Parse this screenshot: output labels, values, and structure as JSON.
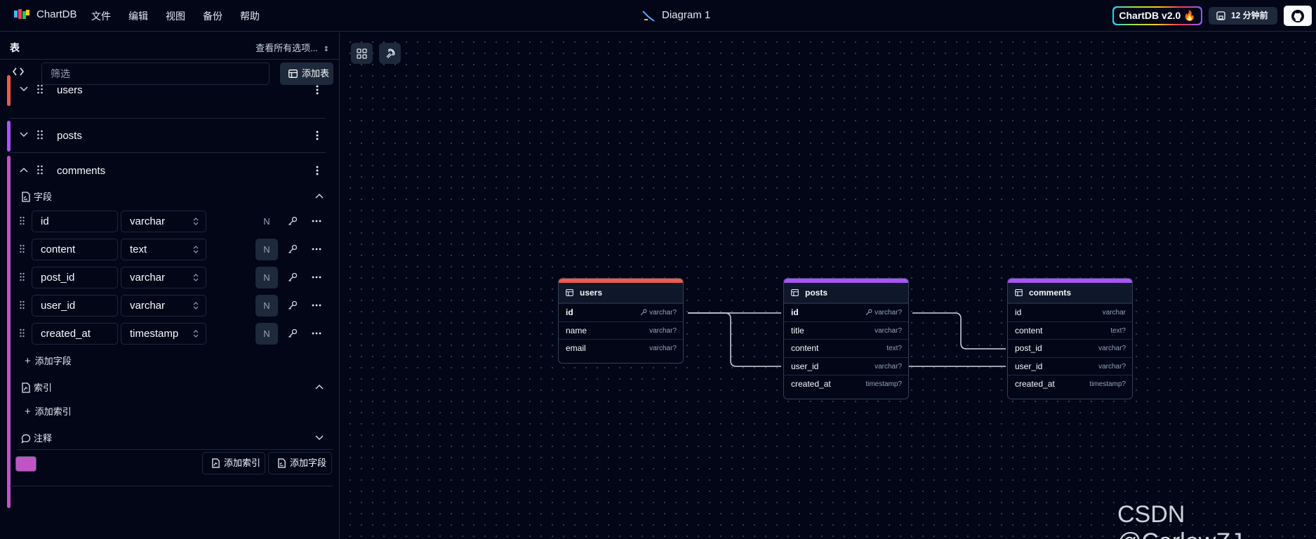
{
  "app": {
    "brand": "ChartDB",
    "menu": [
      "文件",
      "编辑",
      "视图",
      "备份",
      "帮助"
    ],
    "diagram_title": "Diagram 1",
    "version_label": "ChartDB v2.0 🔥",
    "saved_label": "12 分钟前"
  },
  "sidebar": {
    "title": "表",
    "view_all": "查看所有选项...",
    "filter_placeholder": "筛选",
    "add_table": "添加表",
    "tables": [
      {
        "name": "users",
        "color": "#ef5a4c"
      },
      {
        "name": "posts",
        "color": "#a855f7"
      },
      {
        "name": "comments",
        "color": "#c054c6"
      }
    ],
    "fields_section": "字段",
    "fields": [
      {
        "name": "id",
        "type": "varchar",
        "null": "N",
        "nullable": false
      },
      {
        "name": "content",
        "type": "text",
        "null": "N",
        "nullable": true
      },
      {
        "name": "post_id",
        "type": "varchar",
        "null": "N",
        "nullable": true
      },
      {
        "name": "user_id",
        "type": "varchar",
        "null": "N",
        "nullable": true
      },
      {
        "name": "created_at",
        "type": "timestamp",
        "null": "N",
        "nullable": true
      }
    ],
    "add_field": "添加字段",
    "index_section": "索引",
    "add_index": "添加索引",
    "comment_section": "注释",
    "footer_add_index": "添加索引",
    "footer_add_field": "添加字段",
    "table_color": "#c054c6"
  },
  "canvas": {
    "nodes": [
      {
        "name": "users",
        "color": "#ef5a4c",
        "columns": [
          {
            "name": "id",
            "type": "varchar?",
            "pk": true
          },
          {
            "name": "name",
            "type": "varchar?",
            "pk": false
          },
          {
            "name": "email",
            "type": "varchar?",
            "pk": false
          }
        ]
      },
      {
        "name": "posts",
        "color": "#a855f7",
        "columns": [
          {
            "name": "id",
            "type": "varchar?",
            "pk": true
          },
          {
            "name": "title",
            "type": "varchar?",
            "pk": false
          },
          {
            "name": "content",
            "type": "text?",
            "pk": false
          },
          {
            "name": "user_id",
            "type": "varchar?",
            "pk": false
          },
          {
            "name": "created_at",
            "type": "timestamp?",
            "pk": false
          }
        ]
      },
      {
        "name": "comments",
        "color": "#a855f7",
        "columns": [
          {
            "name": "id",
            "type": "varchar",
            "pk": false
          },
          {
            "name": "content",
            "type": "text?",
            "pk": false
          },
          {
            "name": "post_id",
            "type": "varchar?",
            "pk": false
          },
          {
            "name": "user_id",
            "type": "varchar?",
            "pk": false
          },
          {
            "name": "created_at",
            "type": "timestamp?",
            "pk": false
          }
        ]
      }
    ]
  },
  "watermark": "CSDN @CarlowZJ"
}
